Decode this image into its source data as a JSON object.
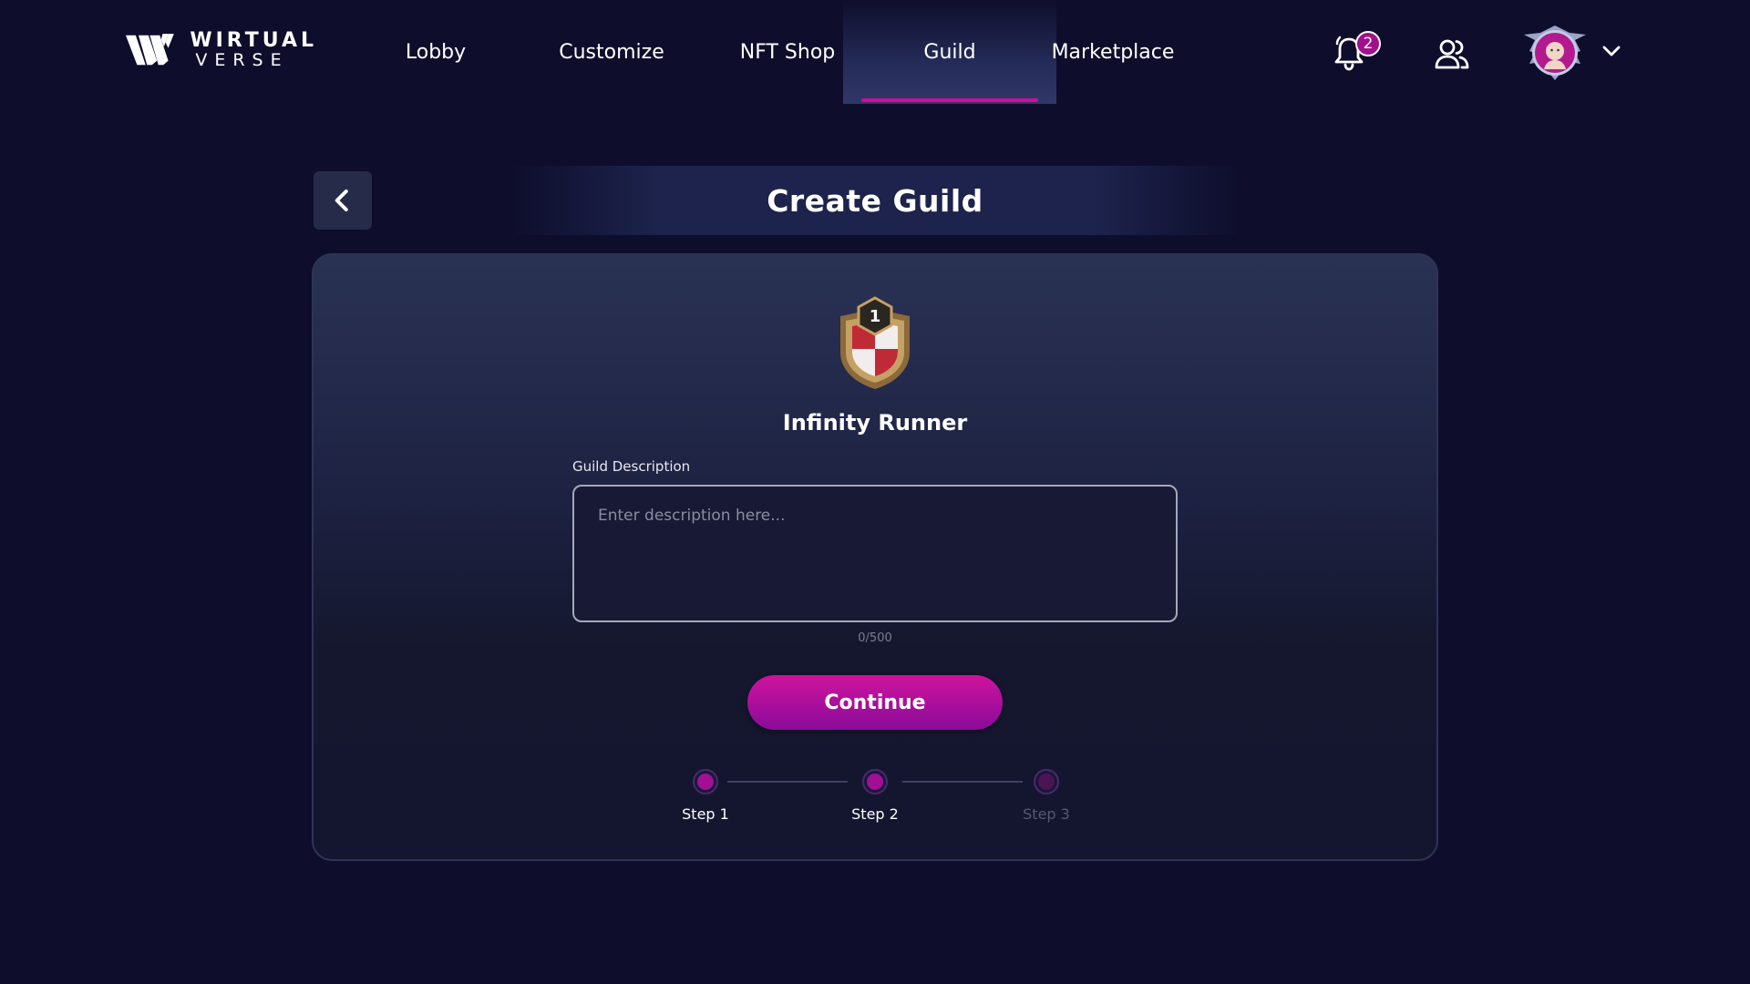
{
  "brand": {
    "line1": "WIRTUAL",
    "line2": "VERSE"
  },
  "nav": {
    "items": [
      {
        "label": "Lobby"
      },
      {
        "label": "Customize"
      },
      {
        "label": "NFT Shop"
      },
      {
        "label": "Guild",
        "active": true
      },
      {
        "label": "Marketplace"
      }
    ],
    "notification_count": "2",
    "icons": [
      "bell-icon",
      "friends-icon",
      "avatar",
      "chevron-down-icon"
    ]
  },
  "header": {
    "title": "Create Guild",
    "back_icon": "chevron-left-icon"
  },
  "guild": {
    "emblem_rank": "1",
    "name": "Infinity Runner"
  },
  "form": {
    "description_label": "Guild Description",
    "description_placeholder": "Enter description here...",
    "description_value": "",
    "counter": "0/500"
  },
  "continue_label": "Continue",
  "steps": [
    {
      "label": "Step 1",
      "state": "done"
    },
    {
      "label": "Step 2",
      "state": "current"
    },
    {
      "label": "Step 3",
      "state": "inactive"
    }
  ],
  "colors": {
    "background": "#0e0e2c",
    "accent": "#d10aa0",
    "button_top": "#cf139c",
    "button_bottom": "#8a0c9a"
  }
}
